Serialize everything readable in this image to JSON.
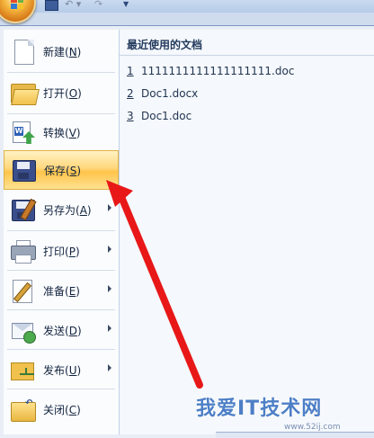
{
  "quick_access": {
    "orb": "office-button",
    "icons": [
      "save-icon",
      "undo-icon",
      "redo-icon",
      "customize-dropdown-icon"
    ]
  },
  "menu": {
    "items": [
      {
        "id": "new",
        "label": "新建(",
        "hotkey": "N",
        "suffix": ")",
        "icon": "new-document-icon",
        "has_submenu": false
      },
      {
        "id": "open",
        "label": "打开(",
        "hotkey": "O",
        "suffix": ")",
        "icon": "open-folder-icon",
        "has_submenu": false
      },
      {
        "id": "convert",
        "label": "转换(",
        "hotkey": "V",
        "suffix": ")",
        "icon": "convert-document-icon",
        "has_submenu": false
      },
      {
        "id": "save",
        "label": "保存(",
        "hotkey": "S",
        "suffix": ")",
        "icon": "save-disk-icon",
        "has_submenu": false,
        "highlighted": true
      },
      {
        "id": "save-as",
        "label": "另存为(",
        "hotkey": "A",
        "suffix": ")",
        "icon": "save-as-icon",
        "has_submenu": true
      },
      {
        "id": "print",
        "label": "打印(",
        "hotkey": "P",
        "suffix": ")",
        "icon": "printer-icon",
        "has_submenu": true
      },
      {
        "id": "prepare",
        "label": "准备(",
        "hotkey": "E",
        "suffix": ")",
        "icon": "prepare-icon",
        "has_submenu": true
      },
      {
        "id": "send",
        "label": "发送(",
        "hotkey": "D",
        "suffix": ")",
        "icon": "send-icon",
        "has_submenu": true
      },
      {
        "id": "publish",
        "label": "发布(",
        "hotkey": "U",
        "suffix": ")",
        "icon": "publish-icon",
        "has_submenu": true
      },
      {
        "id": "close",
        "label": "关闭(",
        "hotkey": "C",
        "suffix": ")",
        "icon": "close-document-icon",
        "has_submenu": false
      }
    ]
  },
  "recent": {
    "title": "最近使用的文档",
    "documents": [
      {
        "num": "1",
        "name": "1111111111111111111.doc"
      },
      {
        "num": "2",
        "name": "Doc1.docx"
      },
      {
        "num": "3",
        "name": "Doc1.doc"
      }
    ]
  },
  "watermark": {
    "text": "我爱IT技术网",
    "url": "www.52ij.com"
  },
  "colors": {
    "highlight": "#ffd77c",
    "annotation_arrow": "#e81818"
  }
}
